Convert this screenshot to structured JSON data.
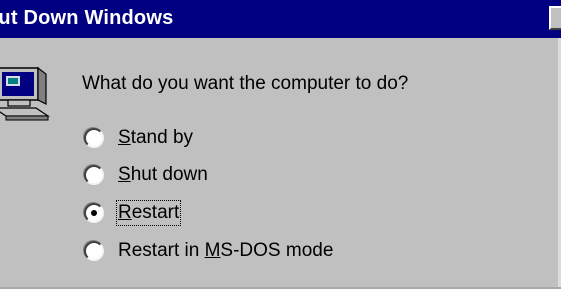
{
  "window": {
    "title": "hut Down Windows"
  },
  "dialog": {
    "prompt": "What do you want the computer to do?",
    "options": [
      {
        "before": "",
        "accel": "S",
        "after": "tand by",
        "selected": false
      },
      {
        "before": "",
        "accel": "S",
        "after": "hut down",
        "selected": false
      },
      {
        "before": "",
        "accel": "R",
        "after": "estart",
        "selected": true
      },
      {
        "before": "Restart in ",
        "accel": "M",
        "after": "S-DOS mode",
        "selected": false
      }
    ]
  },
  "colors": {
    "titlebar": "#000080",
    "face": "#c0c0c0"
  },
  "icons": [
    "computer-icon"
  ]
}
